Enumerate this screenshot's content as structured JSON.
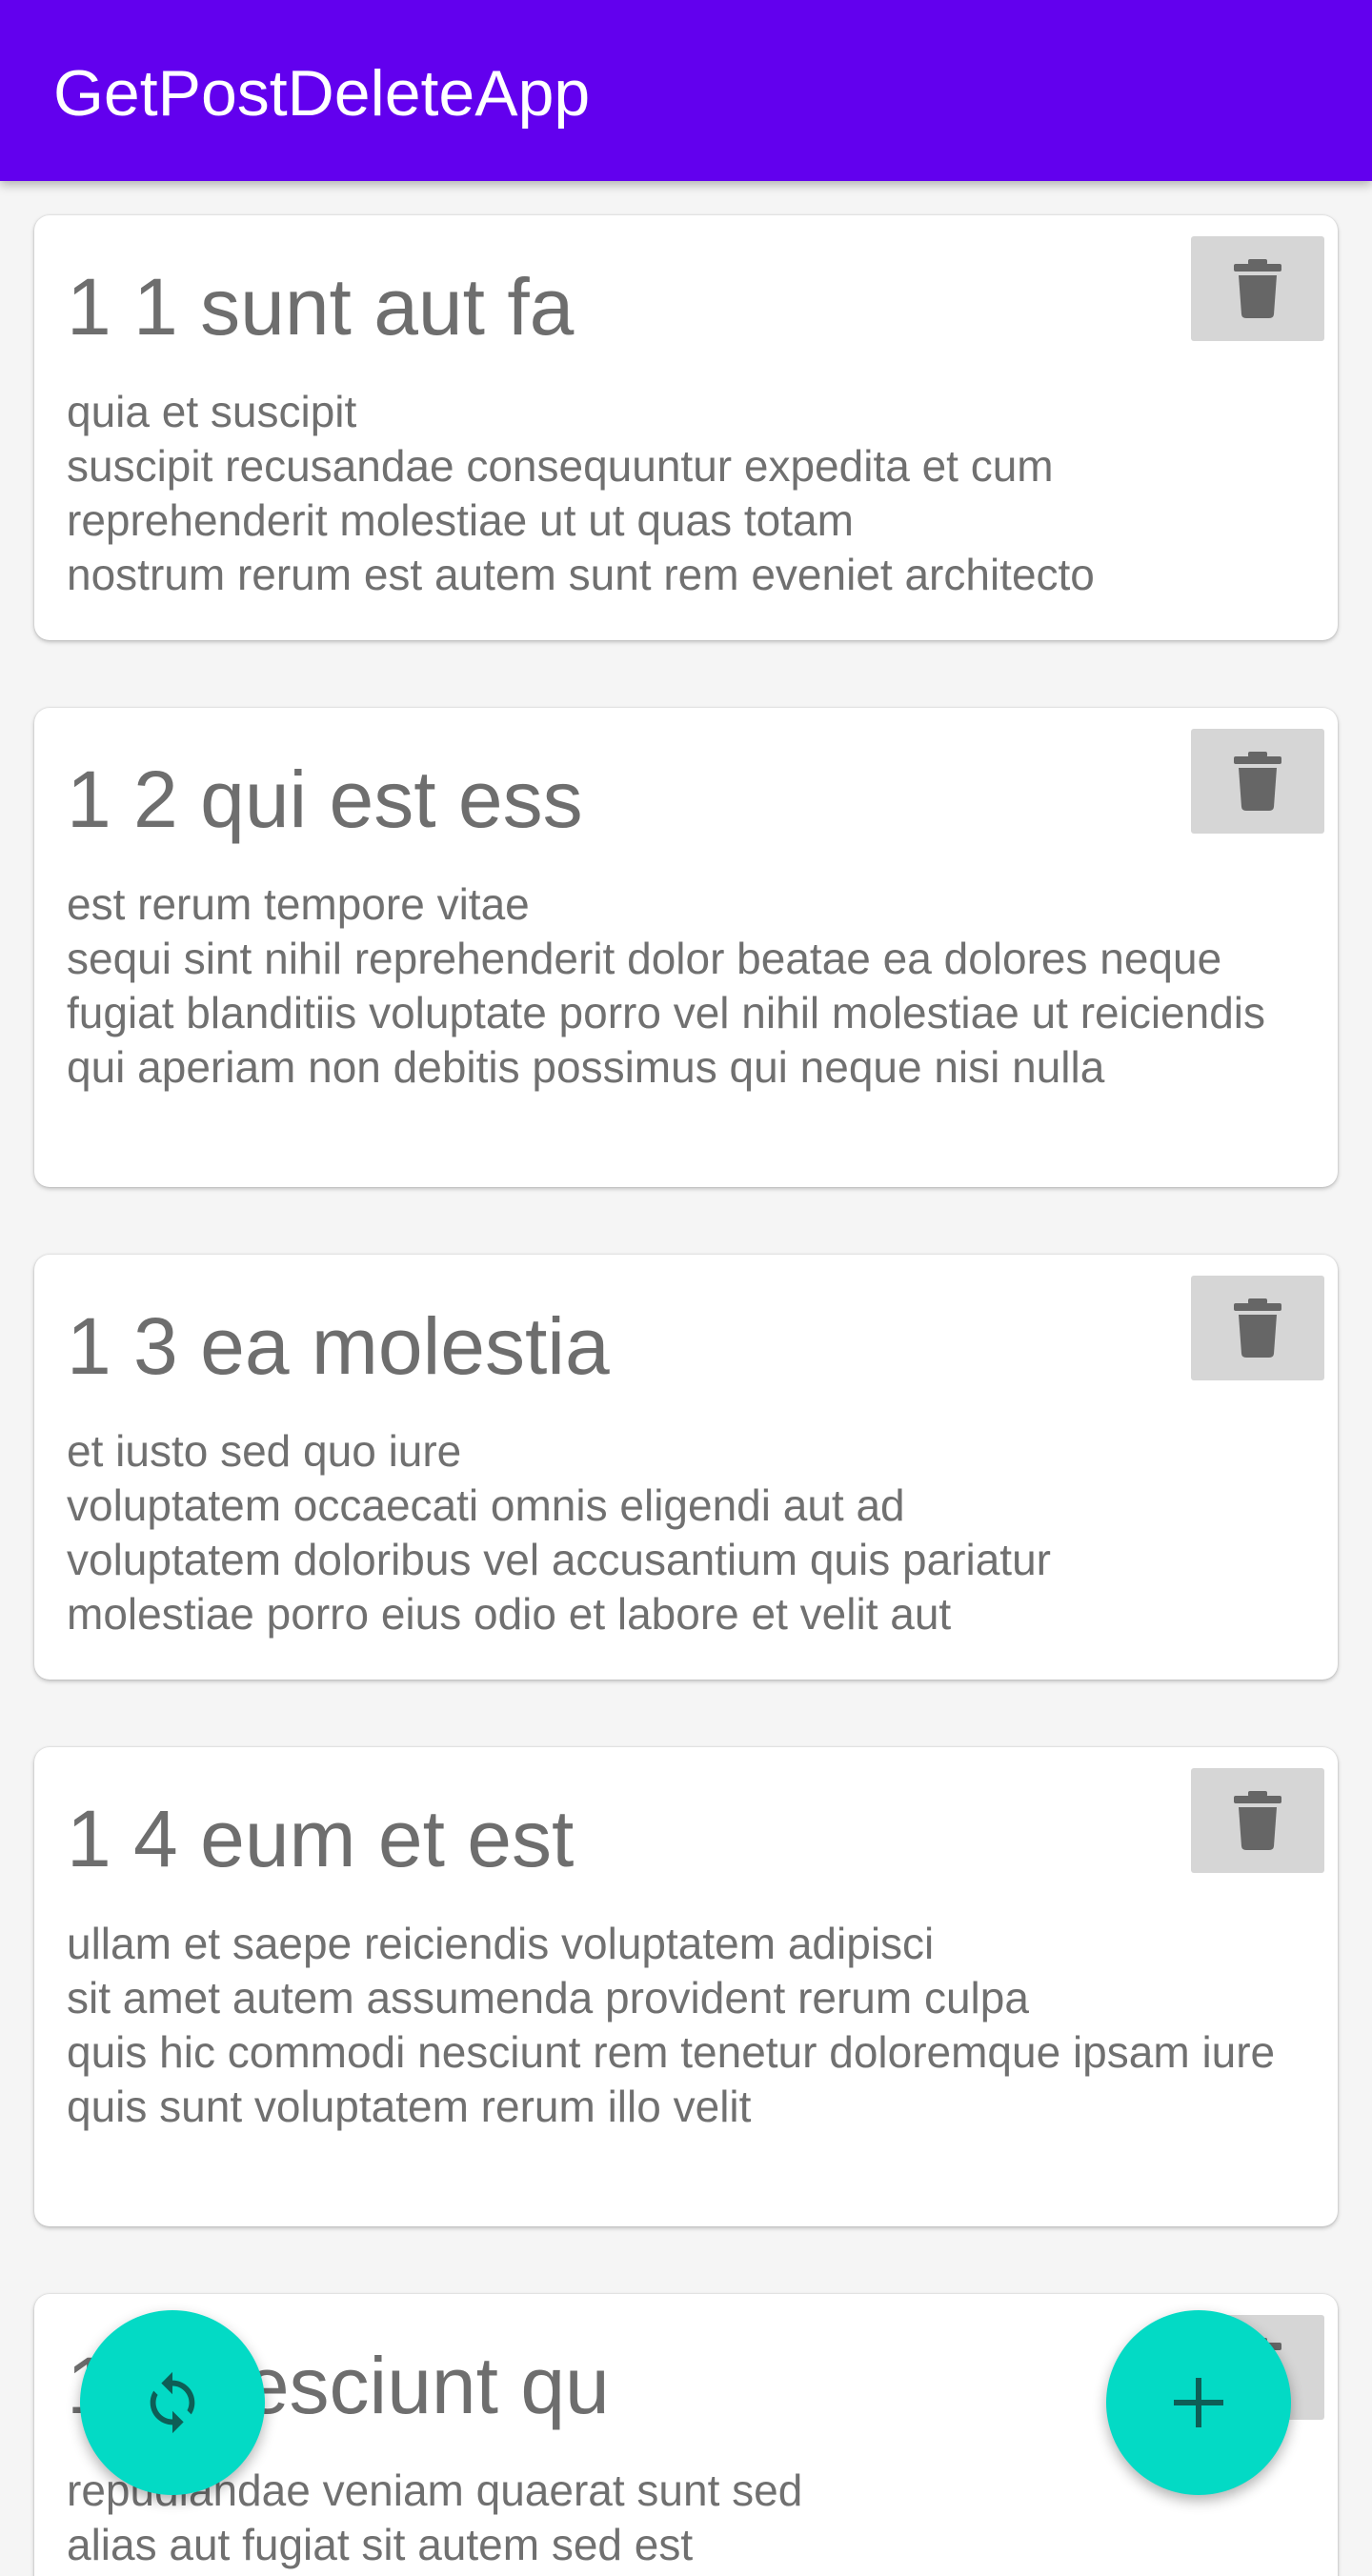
{
  "app": {
    "title": "GetPostDeleteApp"
  },
  "posts": [
    {
      "title": "1 1 sunt aut fa",
      "body": "quia et suscipit\nsuscipit recusandae consequuntur expedita et cum\nreprehenderit molestiae ut ut quas totam\nnostrum rerum est autem sunt rem eveniet architecto"
    },
    {
      "title": "1 2 qui est ess",
      "body": "est rerum tempore vitae\nsequi sint nihil reprehenderit dolor beatae ea dolores neque\nfugiat blanditiis voluptate porro vel nihil molestiae ut reiciendis\nqui aperiam non debitis possimus qui neque nisi nulla"
    },
    {
      "title": "1 3 ea molestia",
      "body": "et iusto sed quo iure\nvoluptatem occaecati omnis eligendi aut ad\nvoluptatem doloribus vel accusantium quis pariatur\nmolestiae porro eius odio et labore et velit aut"
    },
    {
      "title": "1 4 eum et est",
      "body": "ullam et saepe reiciendis voluptatem adipisci\nsit amet autem assumenda provident rerum culpa\nquis hic commodi nesciunt rem tenetur doloremque ipsam iure\nquis sunt voluptatem rerum illo velit"
    },
    {
      "title": "1 5 nesciunt qu",
      "body": "repudiandae veniam quaerat sunt sed\nalias aut fugiat sit autem sed est"
    }
  ],
  "icons": {
    "delete": "trash-icon",
    "refresh": "refresh-icon",
    "add": "plus-icon"
  },
  "colors": {
    "appbar": "#6200ee",
    "fab": "#03dac5",
    "delete_button_bg": "#d6d6d6",
    "icon": "#666666",
    "text": "#707070",
    "background": "#f5f5f5"
  }
}
